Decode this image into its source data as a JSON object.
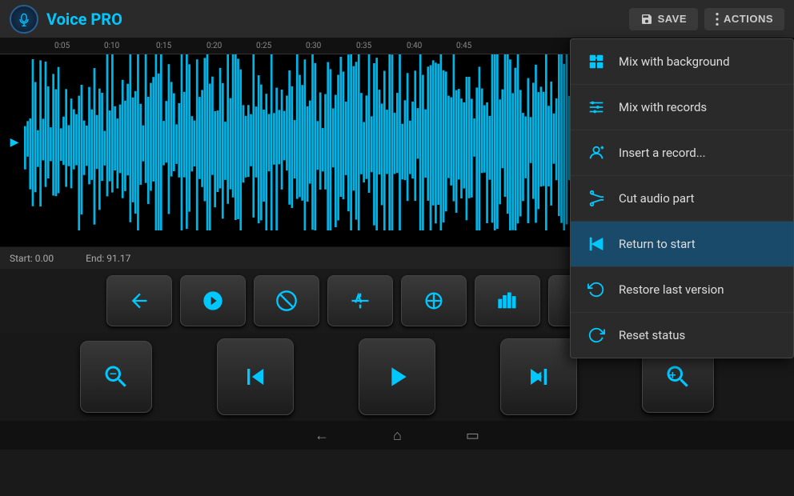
{
  "app": {
    "logo_alt": "Voice PRO Logo",
    "title_plain": "Voice ",
    "title_accent": "PRO"
  },
  "header": {
    "save_label": "SAVE",
    "actions_label": "ACTIONS"
  },
  "timeline": {
    "markers": [
      "0:05",
      "0:10",
      "0:15",
      "0:20",
      "0:25",
      "0:30",
      "0:35",
      "0:40",
      "0:45"
    ],
    "start_label": "Start:",
    "start_value": "0.00",
    "end_label": "End:",
    "end_value": "91.17"
  },
  "menu": {
    "items": [
      {
        "id": "mix-background",
        "label": "Mix with background",
        "icon": "⊞"
      },
      {
        "id": "mix-records",
        "label": "Mix with records",
        "icon": "⊟"
      },
      {
        "id": "insert-record",
        "label": "Insert a record...",
        "icon": "↺"
      },
      {
        "id": "cut-audio",
        "label": "Cut audio part",
        "icon": "✂"
      },
      {
        "id": "return-start",
        "label": "Return to start",
        "icon": "⤓"
      },
      {
        "id": "restore-last",
        "label": "Restore last version",
        "icon": "↻"
      },
      {
        "id": "reset-status",
        "label": "Reset status",
        "icon": "↺"
      }
    ]
  },
  "controls": {
    "buttons": [
      {
        "id": "undo",
        "icon": "↩"
      },
      {
        "id": "run",
        "icon": "⚡"
      },
      {
        "id": "stop",
        "icon": "⊘"
      },
      {
        "id": "normalize",
        "icon": "↕"
      },
      {
        "id": "balance",
        "icon": "◎"
      },
      {
        "id": "equalizer",
        "icon": "▦"
      },
      {
        "id": "waveform",
        "icon": "∿"
      },
      {
        "id": "effects",
        "icon": "⊞"
      }
    ]
  },
  "transport": {
    "buttons": [
      {
        "id": "search-zoom-out",
        "icon": "🔍"
      },
      {
        "id": "skip-back",
        "icon": "⏮"
      },
      {
        "id": "play",
        "icon": "▶"
      },
      {
        "id": "skip-forward",
        "icon": "⏭"
      },
      {
        "id": "search-zoom-in",
        "icon": "🔎"
      }
    ]
  },
  "nav": {
    "back_icon": "←",
    "home_icon": "⌂",
    "recents_icon": "▭"
  }
}
